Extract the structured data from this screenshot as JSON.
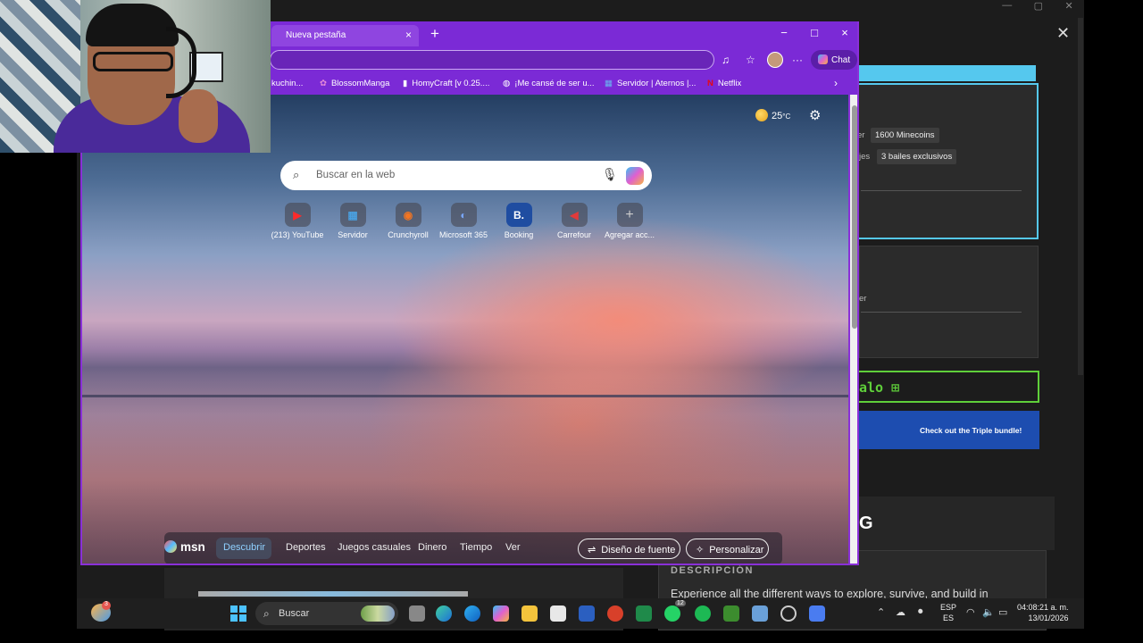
{
  "background_app": {
    "pill_1": "1600 Minecoins",
    "pill_1_prefix": "er",
    "pill_2": "3 bailes exclusivos",
    "pill_2_prefix": "jes",
    "misc_text": "er",
    "gift_button": "alo",
    "gift_icon": "gift-icon",
    "banner_text": "Check out the Triple bundle!",
    "big_letter": "G",
    "description_title": "DESCRIPCIÓN",
    "description_text": "Experience all the different ways to explore, survive, and build in"
  },
  "browser": {
    "tab_title": "Nueva pestaña",
    "tab_close": "×",
    "new_tab": "+",
    "window_controls": {
      "minimize": "−",
      "maximize": "□",
      "close": "×"
    },
    "chat_label": "Chat",
    "favorites": [
      {
        "label": "kuchin...",
        "icon": "folder-icon"
      },
      {
        "label": "BlossomManga",
        "icon": "flower-icon"
      },
      {
        "label": "HomyCraft [v 0.25....",
        "icon": "bookmark-icon"
      },
      {
        "label": "¡Me cansé de ser u...",
        "icon": "globe-icon"
      },
      {
        "label": "Servidor | Aternos |...",
        "icon": "server-icon"
      },
      {
        "label": "Netflix",
        "icon": "netflix-icon"
      }
    ],
    "weather": {
      "temp": "25",
      "unit": "°C"
    },
    "search_placeholder": "Buscar en la web",
    "shortcuts": [
      {
        "label": "(213) YouTube",
        "glyph": "▶",
        "color": "#ff2a2a"
      },
      {
        "label": "Servidor",
        "glyph": "▦",
        "color": "#4aa0e0"
      },
      {
        "label": "Crunchyroll",
        "glyph": "◉",
        "color": "#f47521"
      },
      {
        "label": "Microsoft 365",
        "glyph": "◐",
        "color": "#7aa9ff"
      },
      {
        "label": "Booking",
        "glyph": "B.",
        "color": "#1f4da1"
      },
      {
        "label": "Carrefour",
        "glyph": "◀",
        "color": "#e03a3a"
      },
      {
        "label": "Agregar acc...",
        "glyph": "+",
        "color": "#cccccc"
      }
    ],
    "msn": {
      "logo": "msn",
      "nav": [
        "Descubrir",
        "Deportes",
        "Juegos casuales",
        "Dinero",
        "Tiempo",
        "Ver"
      ],
      "active": "Descubrir",
      "font_button": "Diseño de fuente",
      "customize_button": "Personalizar"
    }
  },
  "taskbar": {
    "widget_badge": "3",
    "search_label": "Buscar",
    "whatsapp_badge": "12",
    "lang_top": "ESP",
    "lang_bottom": "ES",
    "time": "04:08:21 a. m.",
    "date": "13/01/2026"
  },
  "colors": {
    "accent": "#7b2ad6",
    "cyan": "#55c8ee",
    "green": "#5fcf3a",
    "blue_banner": "#1d4db0"
  }
}
